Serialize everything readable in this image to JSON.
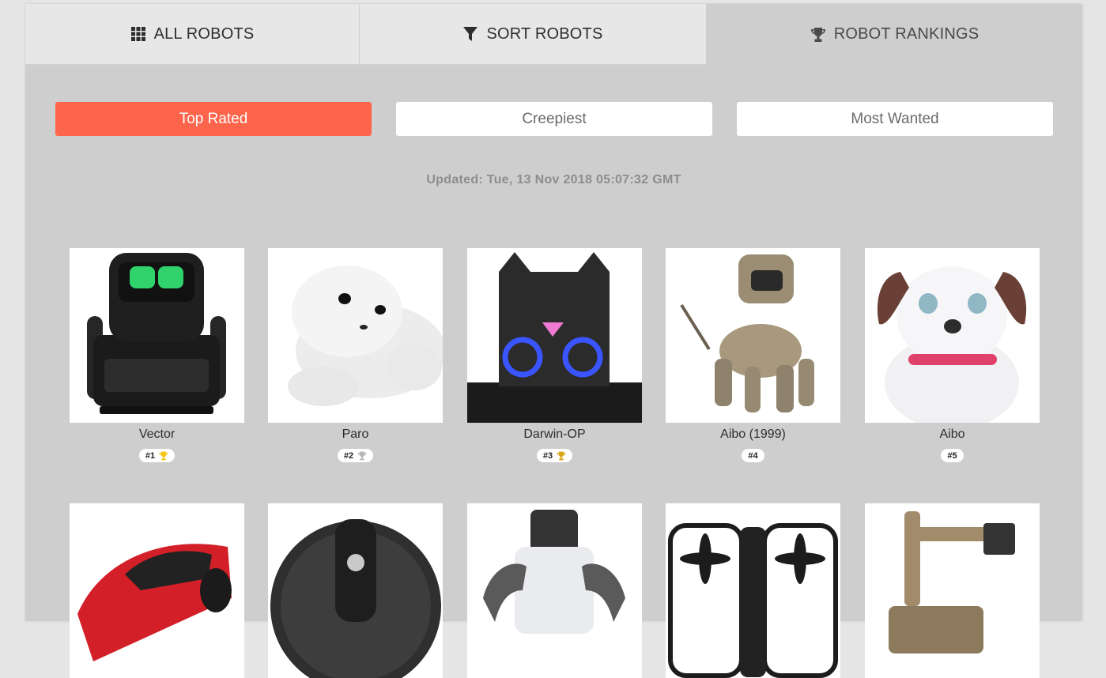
{
  "nav": {
    "tabs": [
      {
        "label": "ALL ROBOTS",
        "icon": "grid-icon"
      },
      {
        "label": "SORT ROBOTS",
        "icon": "filter-icon"
      },
      {
        "label": "ROBOT RANKINGS",
        "icon": "trophy-icon",
        "active": true
      }
    ]
  },
  "filters": [
    {
      "label": "Top Rated",
      "active": true
    },
    {
      "label": "Creepiest"
    },
    {
      "label": "Most Wanted"
    }
  ],
  "updated_text": "Updated: Tue, 13 Nov 2018 05:07:32 GMT",
  "robots": [
    {
      "name": "Vector",
      "rank": "#1",
      "trophy": "gold"
    },
    {
      "name": "Paro",
      "rank": "#2",
      "trophy": "silver"
    },
    {
      "name": "Darwin-OP",
      "rank": "#3",
      "trophy": "bronze"
    },
    {
      "name": "Aibo (1999)",
      "rank": "#4"
    },
    {
      "name": "Aibo",
      "rank": "#5"
    }
  ],
  "colors": {
    "accent": "#fd644c",
    "panel": "#cecece",
    "tab": "#e7e7e7",
    "gold": "#f5c518",
    "silver": "#b8b8b8",
    "bronze": "#d9a414"
  }
}
